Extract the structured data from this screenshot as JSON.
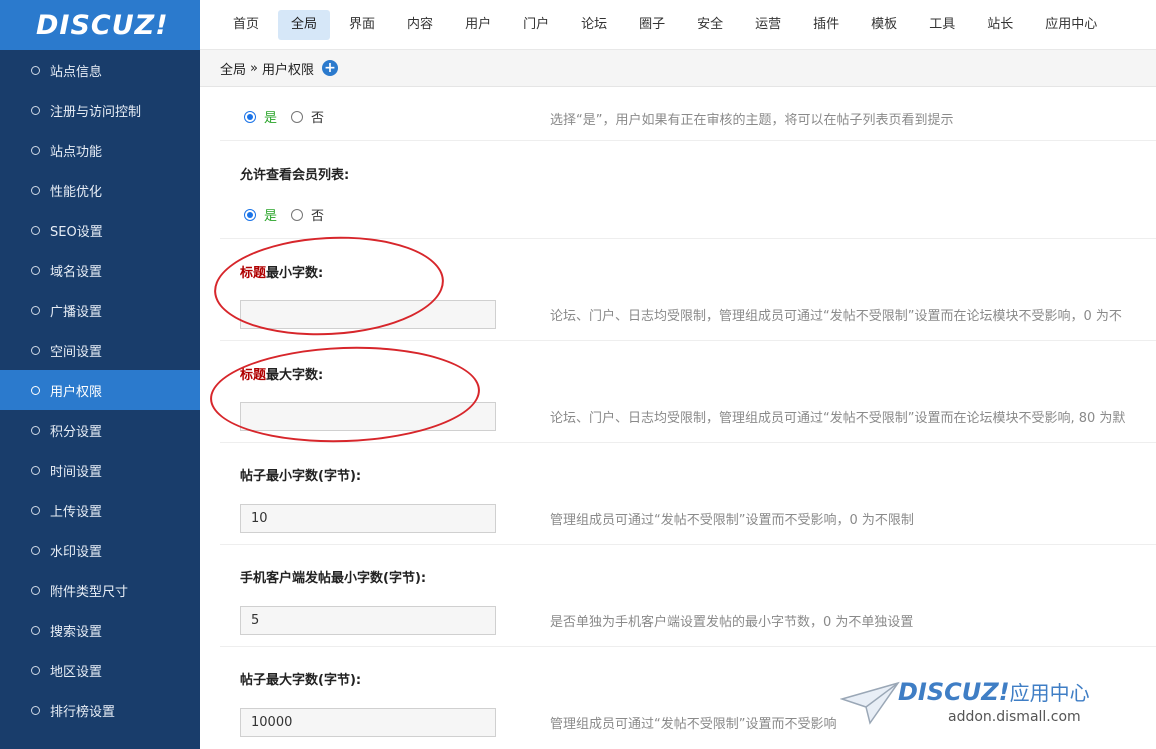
{
  "logo": {
    "text": "DISCUZ!"
  },
  "topnav": {
    "items": [
      {
        "label": "首页"
      },
      {
        "label": "全局",
        "active": true
      },
      {
        "label": "界面"
      },
      {
        "label": "内容"
      },
      {
        "label": "用户"
      },
      {
        "label": "门户"
      },
      {
        "label": "论坛"
      },
      {
        "label": "圈子"
      },
      {
        "label": "安全"
      },
      {
        "label": "运营"
      },
      {
        "label": "插件"
      },
      {
        "label": "模板"
      },
      {
        "label": "工具"
      },
      {
        "label": "站长"
      },
      {
        "label": "应用中心"
      }
    ]
  },
  "sidebar": {
    "items": [
      {
        "label": "站点信息"
      },
      {
        "label": "注册与访问控制"
      },
      {
        "label": "站点功能"
      },
      {
        "label": "性能优化"
      },
      {
        "label": "SEO设置"
      },
      {
        "label": "域名设置"
      },
      {
        "label": "广播设置"
      },
      {
        "label": "空间设置"
      },
      {
        "label": "用户权限",
        "active": true
      },
      {
        "label": "积分设置"
      },
      {
        "label": "时间设置"
      },
      {
        "label": "上传设置"
      },
      {
        "label": "水印设置"
      },
      {
        "label": "附件类型尺寸"
      },
      {
        "label": "搜索设置"
      },
      {
        "label": "地区设置"
      },
      {
        "label": "排行榜设置"
      }
    ]
  },
  "breadcrumb": {
    "parent": "全局",
    "separator": "»",
    "current": "用户权限"
  },
  "settings": {
    "s0": {
      "yes": "是",
      "no": "否",
      "help": "选择“是”，用户如果有正在审核的主题，将可以在帖子列表页看到提示"
    },
    "s1": {
      "label": "允许查看会员列表:",
      "yes": "是",
      "no": "否"
    },
    "s2": {
      "label_red": "标题",
      "label_rest": "最小字数:",
      "value": "",
      "help": "论坛、门户、日志均受限制，管理组成员可通过“发帖不受限制”设置而在论坛模块不受影响，0 为不"
    },
    "s3": {
      "label_red": "标题",
      "label_rest": "最大字数:",
      "value": "",
      "help": "论坛、门户、日志均受限制，管理组成员可通过“发帖不受限制”设置而在论坛模块不受影响, 80 为默"
    },
    "s4": {
      "label": "帖子最小字数(字节):",
      "value": "10",
      "help": "管理组成员可通过“发帖不受限制”设置而不受影响，0 为不限制"
    },
    "s5": {
      "label": "手机客户端发帖最小字数(字节):",
      "value": "5",
      "help": "是否单独为手机客户端设置发帖的最小字节数，0 为不单独设置"
    },
    "s6": {
      "label": "帖子最大字数(字节):",
      "value": "10000",
      "help": "管理组成员可通过“发帖不受限制”设置而不受影响"
    }
  },
  "watermark": {
    "brand": "DISCUZ!",
    "brand_cn": "应用中心",
    "url": "addon.dismall.com"
  },
  "colors": {
    "sidebar_bg": "#193d6b",
    "accent": "#2b7acd",
    "annotation": "#d7262b"
  }
}
